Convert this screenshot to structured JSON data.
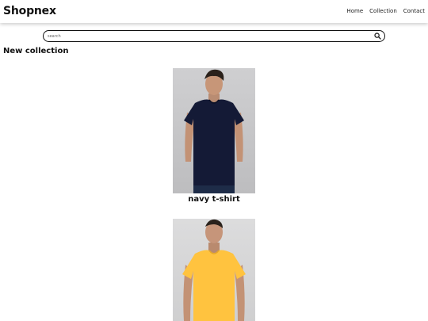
{
  "brand": "Shopnex",
  "nav": [
    "Home",
    "Collection",
    "Contact"
  ],
  "search": {
    "placeholder": "search"
  },
  "section_title": "New collection",
  "products": [
    {
      "name": "navy t-shirt",
      "color": "#141a36"
    },
    {
      "name": "",
      "color": "#ffc33f"
    }
  ],
  "icons": {
    "search": "search-icon"
  }
}
